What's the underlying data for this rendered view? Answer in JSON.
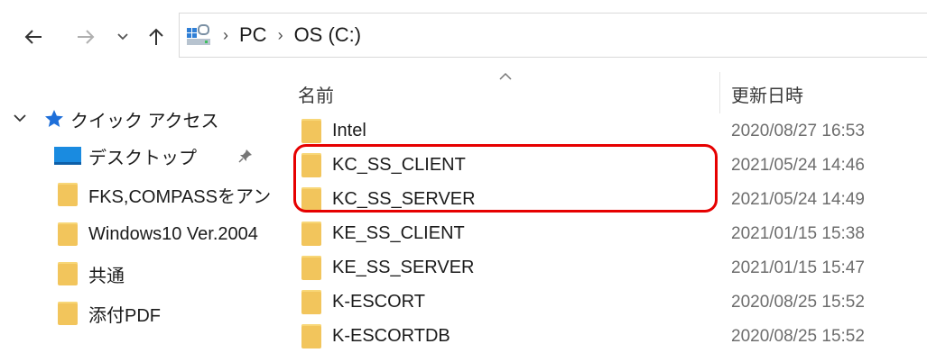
{
  "nav": {
    "back_icon": "arrow-left-icon",
    "forward_icon": "arrow-right-icon",
    "recent_icon": "chevron-down-icon",
    "up_icon": "arrow-up-icon"
  },
  "address": {
    "icon": "drive-icon",
    "crumbs": [
      "PC",
      "OS (C:)"
    ]
  },
  "sidebar": {
    "quick_access": "クイック アクセス",
    "items": [
      {
        "label": "デスクトップ",
        "icon": "desktop-icon",
        "pinned": true
      },
      {
        "label": "FKS,COMPASSをアン",
        "icon": "folder-icon"
      },
      {
        "label": "Windows10 Ver.2004",
        "icon": "folder-icon"
      },
      {
        "label": "共通",
        "icon": "folder-icon"
      },
      {
        "label": "添付PDF",
        "icon": "folder-icon"
      }
    ]
  },
  "columns": {
    "name": "名前",
    "date": "更新日時",
    "sort_icon": "sort-up-icon"
  },
  "files": [
    {
      "name": "Intel",
      "date": "2020/08/27 16:53"
    },
    {
      "name": "KC_SS_CLIENT",
      "date": "2021/05/24 14:46"
    },
    {
      "name": "KC_SS_SERVER",
      "date": "2021/05/24 14:49"
    },
    {
      "name": "KE_SS_CLIENT",
      "date": "2021/01/15 15:38"
    },
    {
      "name": "KE_SS_SERVER",
      "date": "2021/01/15 15:47"
    },
    {
      "name": "K-ESCORT",
      "date": "2020/08/25 15:52"
    },
    {
      "name": "K-ESCORTDB",
      "date": "2020/08/25 15:52"
    }
  ],
  "colors": {
    "highlight": "#e60000",
    "folder": "#f2c55c",
    "quick_access_star": "#1e6fd9"
  }
}
